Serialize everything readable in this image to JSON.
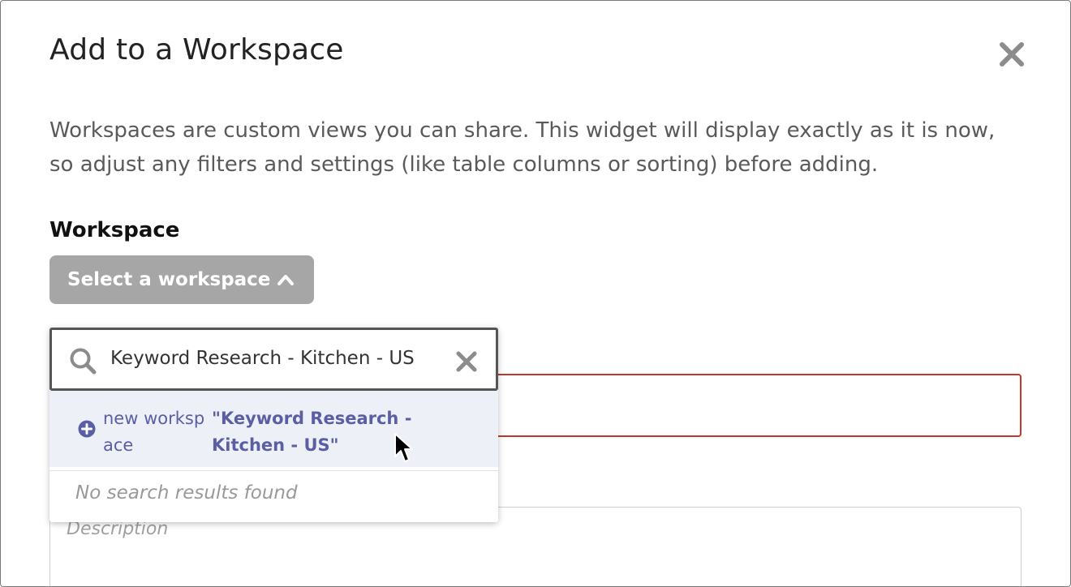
{
  "dialog": {
    "title": "Add to a Workspace",
    "intro": "Workspaces are custom views you can share. This widget will display exactly as it is now, so adjust any filters and settings (like table columns or sorting) before adding.",
    "close_icon": "close-icon"
  },
  "workspace": {
    "label": "Workspace",
    "select_button_label": "Select a workspace",
    "select_button_icon": "chevron-up-icon"
  },
  "dropdown": {
    "search_value": "Keyword Research - Kitchen - US",
    "search_icon": "search-icon",
    "clear_icon": "clear-icon",
    "new_option_prefix": "new workspace",
    "new_option_name": "\"Keyword Research - Kitchen - US\"",
    "new_option_icon": "plus-circle-icon",
    "no_results": "No search results found"
  },
  "description": {
    "placeholder": "Description"
  },
  "colors": {
    "accent": "#5b5ea3",
    "button_gray": "#a6a6a6",
    "error_border": "#c0392b",
    "option_highlight": "#eef0f7"
  }
}
